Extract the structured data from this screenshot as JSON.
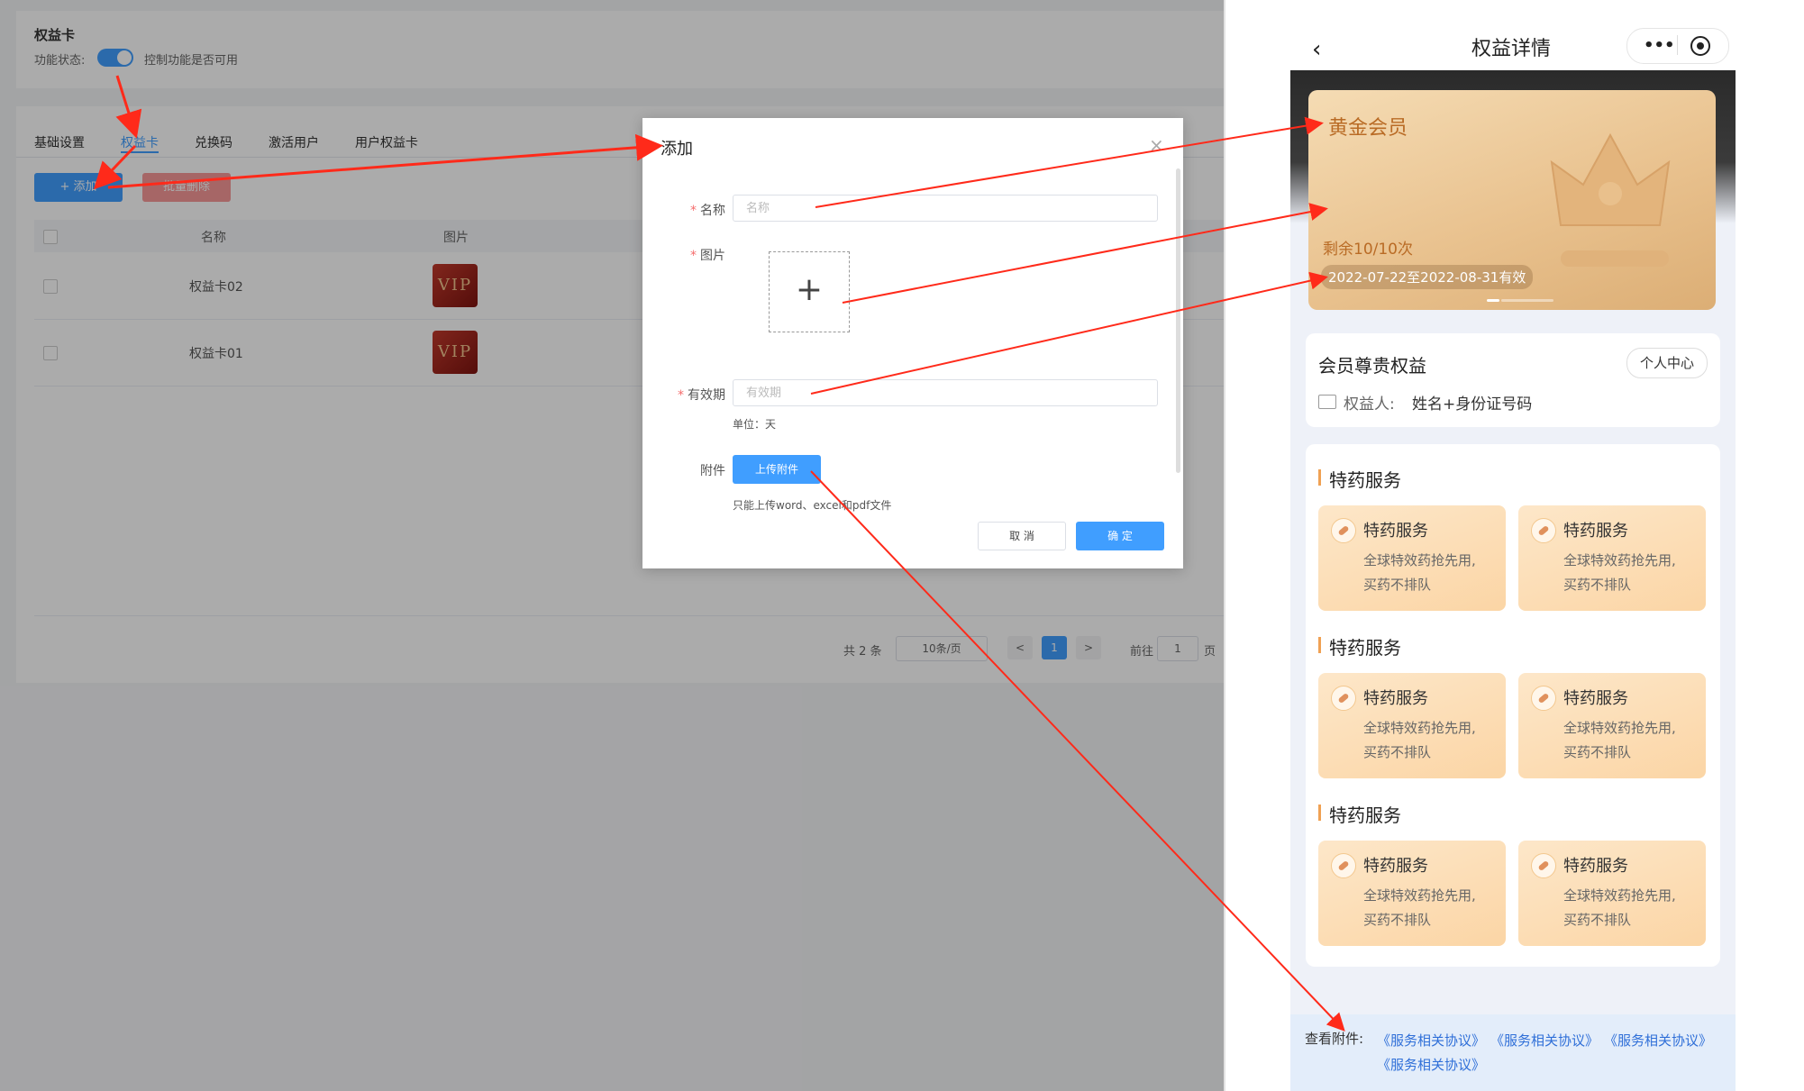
{
  "admin": {
    "section_title": "权益卡",
    "status_label": "功能状态:",
    "status_hint": "控制功能是否可用",
    "tabs": [
      {
        "label": "基础设置"
      },
      {
        "label": "权益卡"
      },
      {
        "label": "兑换码"
      },
      {
        "label": "激活用户"
      },
      {
        "label": "用户权益卡"
      }
    ],
    "add_button": "+ 添加",
    "batch_delete_button": "批量删除",
    "table": {
      "headers": [
        "名称",
        "图片"
      ],
      "rows": [
        {
          "name": "权益卡02",
          "image_text": "VIP"
        },
        {
          "name": "权益卡01",
          "image_text": "VIP"
        }
      ]
    },
    "pagination": {
      "total": "共 2 条",
      "page_size": "10条/页",
      "prev": "<",
      "current": "1",
      "next": ">",
      "goto_label": "前往",
      "goto_value": "1",
      "page_suffix": "页"
    }
  },
  "dialog": {
    "title": "添加",
    "close": "×",
    "fields": {
      "name_label": "名称",
      "name_placeholder": "名称",
      "image_label": "图片",
      "upload_plus": "+",
      "validity_label": "有效期",
      "validity_placeholder": "有效期",
      "unit_hint": "单位：天",
      "attachment_label": "附件",
      "upload_button": "上传附件",
      "attachment_hint": "只能上传word、excel和pdf文件"
    },
    "cancel": "取 消",
    "confirm": "确 定"
  },
  "phone": {
    "nav_title": "权益详情",
    "back_icon": "chevron-left-icon",
    "member_card": {
      "level": "黄金会员",
      "remaining": "剩余10/10次",
      "validity": "2022-07-22至2022-08-31有效"
    },
    "rights": {
      "title": "会员尊贵权益",
      "center_button": "个人中心",
      "holder_label": "权益人:",
      "holder_value": "姓名+身份证号码"
    },
    "service_groups": [
      {
        "title": "特药服务",
        "items": [
          {
            "name": "特药服务",
            "desc1": "全球特效药抢先用,",
            "desc2": "买药不排队"
          },
          {
            "name": "特药服务",
            "desc1": "全球特效药抢先用,",
            "desc2": "买药不排队"
          }
        ]
      },
      {
        "title": "特药服务",
        "items": [
          {
            "name": "特药服务",
            "desc1": "全球特效药抢先用,",
            "desc2": "买药不排队"
          },
          {
            "name": "特药服务",
            "desc1": "全球特效药抢先用,",
            "desc2": "买药不排队"
          }
        ]
      },
      {
        "title": "特药服务",
        "items": [
          {
            "name": "特药服务",
            "desc1": "全球特效药抢先用,",
            "desc2": "买药不排队"
          },
          {
            "name": "特药服务",
            "desc1": "全球特效药抢先用,",
            "desc2": "买药不排队"
          }
        ]
      }
    ],
    "attachments": {
      "label": "查看附件:",
      "links": [
        "《服务相关协议》",
        "《服务相关协议》",
        "《服务相关协议》",
        "《服务相关协议》"
      ]
    }
  },
  "colors": {
    "primary": "#409eff",
    "danger": "#f56c6c",
    "gold": "#e9c28f",
    "gold_text": "#b86a25",
    "annotation_arrow": "#ff2a1a"
  }
}
